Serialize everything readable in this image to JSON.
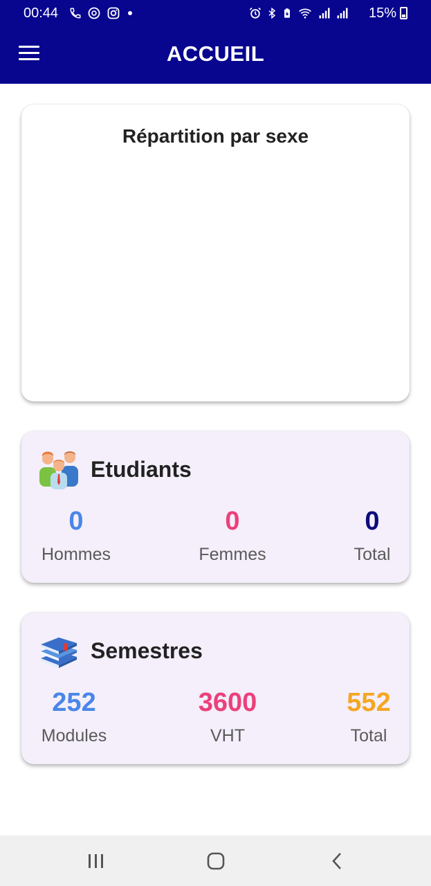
{
  "status_bar": {
    "time": "00:44",
    "battery_percent": "15%",
    "left_icons": [
      "phone-icon",
      "threads-icon",
      "instagram-icon",
      "dot-icon"
    ],
    "right_icons": [
      "alarm-icon",
      "bluetooth-icon",
      "battery-saver-icon",
      "wifi-icon",
      "signal-icon",
      "signal-icon"
    ]
  },
  "app_bar": {
    "title": "ACCUEIL",
    "color": "#08068f"
  },
  "chart_card": {
    "title": "Répartition par sexe"
  },
  "students": {
    "title": "Etudiants",
    "icon": "students-group-icon",
    "stats": [
      {
        "value": "0",
        "label": "Hommes",
        "color": "#4a86e8"
      },
      {
        "value": "0",
        "label": "Femmes",
        "color": "#ec407a"
      },
      {
        "value": "0",
        "label": "Total",
        "color": "#0d0b7a"
      }
    ]
  },
  "semesters": {
    "title": "Semestres",
    "icon": "books-stack-icon",
    "stats": [
      {
        "value": "252",
        "label": "Modules",
        "color": "#4a86e8"
      },
      {
        "value": "3600",
        "label": "VHT",
        "color": "#ec407a"
      },
      {
        "value": "552",
        "label": "Total",
        "color": "#f5a623"
      }
    ]
  },
  "nav_bar": {
    "buttons": [
      "recents-icon",
      "home-icon",
      "back-icon"
    ]
  }
}
